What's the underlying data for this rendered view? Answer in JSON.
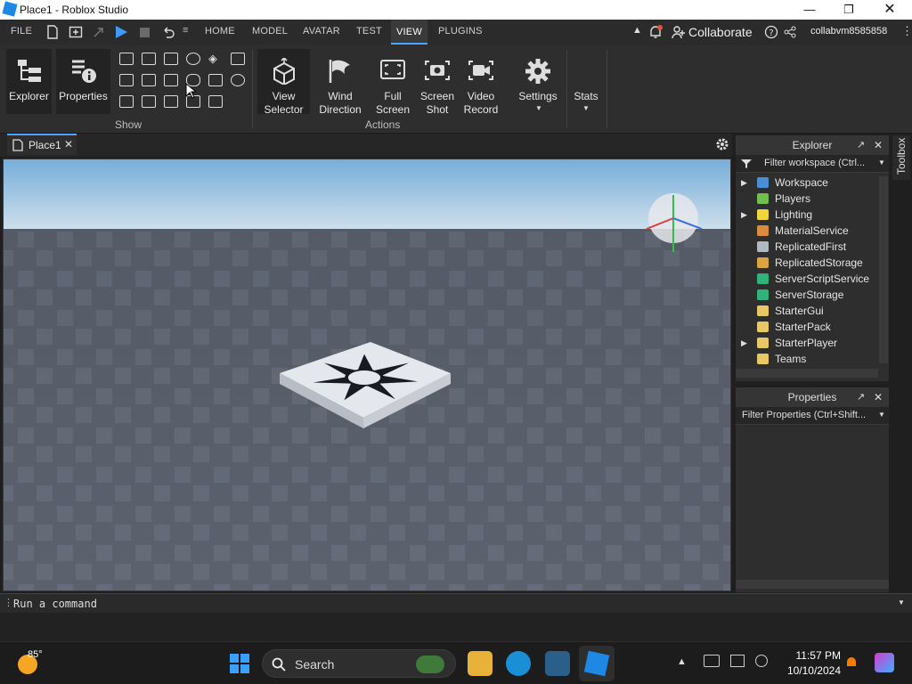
{
  "window": {
    "title": "Place1 - Roblox Studio"
  },
  "menubar": {
    "file": "FILE",
    "tabs": [
      {
        "label": "HOME"
      },
      {
        "label": "MODEL"
      },
      {
        "label": "AVATAR"
      },
      {
        "label": "TEST"
      },
      {
        "label": "VIEW"
      },
      {
        "label": "PLUGINS"
      }
    ],
    "collaborate": "Collaborate",
    "username": "collabvm8585858"
  },
  "ribbon": {
    "explorer": "Explorer",
    "properties": "Properties",
    "show_group": "Show",
    "view_selector": [
      "View",
      "Selector"
    ],
    "wind_direction": [
      "Wind",
      "Direction"
    ],
    "full_screen": [
      "Full",
      "Screen"
    ],
    "screen_shot": [
      "Screen",
      "Shot"
    ],
    "video_record": [
      "Video",
      "Record"
    ],
    "settings": "Settings",
    "stats": "Stats",
    "actions_group": "Actions"
  },
  "doc_tab": {
    "label": "Place1"
  },
  "explorer": {
    "title": "Explorer",
    "filter_placeholder": "Filter workspace (Ctrl...",
    "items": [
      {
        "label": "Workspace",
        "expandable": true,
        "color": "#4a8fd6"
      },
      {
        "label": "Players",
        "expandable": false,
        "color": "#6fbf4f"
      },
      {
        "label": "Lighting",
        "expandable": true,
        "color": "#f2d43b"
      },
      {
        "label": "MaterialService",
        "expandable": false,
        "color": "#d98c3f"
      },
      {
        "label": "ReplicatedFirst",
        "expandable": false,
        "color": "#b0b8c4"
      },
      {
        "label": "ReplicatedStorage",
        "expandable": false,
        "color": "#d9a441"
      },
      {
        "label": "ServerScriptService",
        "expandable": false,
        "color": "#2fb37a"
      },
      {
        "label": "ServerStorage",
        "expandable": false,
        "color": "#2fb37a"
      },
      {
        "label": "StarterGui",
        "expandable": false,
        "color": "#e8c766"
      },
      {
        "label": "StarterPack",
        "expandable": false,
        "color": "#e8c766"
      },
      {
        "label": "StarterPlayer",
        "expandable": true,
        "color": "#e8c766"
      },
      {
        "label": "Teams",
        "expandable": false,
        "color": "#e8c766"
      }
    ]
  },
  "properties": {
    "title": "Properties",
    "filter_placeholder": "Filter Properties (Ctrl+Shift..."
  },
  "toolbox": {
    "label": "Toolbox"
  },
  "command_bar": {
    "placeholder": "Run a command"
  },
  "taskbar": {
    "weather_temp": "85°",
    "search_label": "Search",
    "time": "11:57 PM",
    "date": "10/10/2024"
  },
  "colors": {
    "accent": "#4aa3ff",
    "play": "#3d9bff",
    "sky_top": "#7fb3dc",
    "floor": "#5c6270"
  }
}
